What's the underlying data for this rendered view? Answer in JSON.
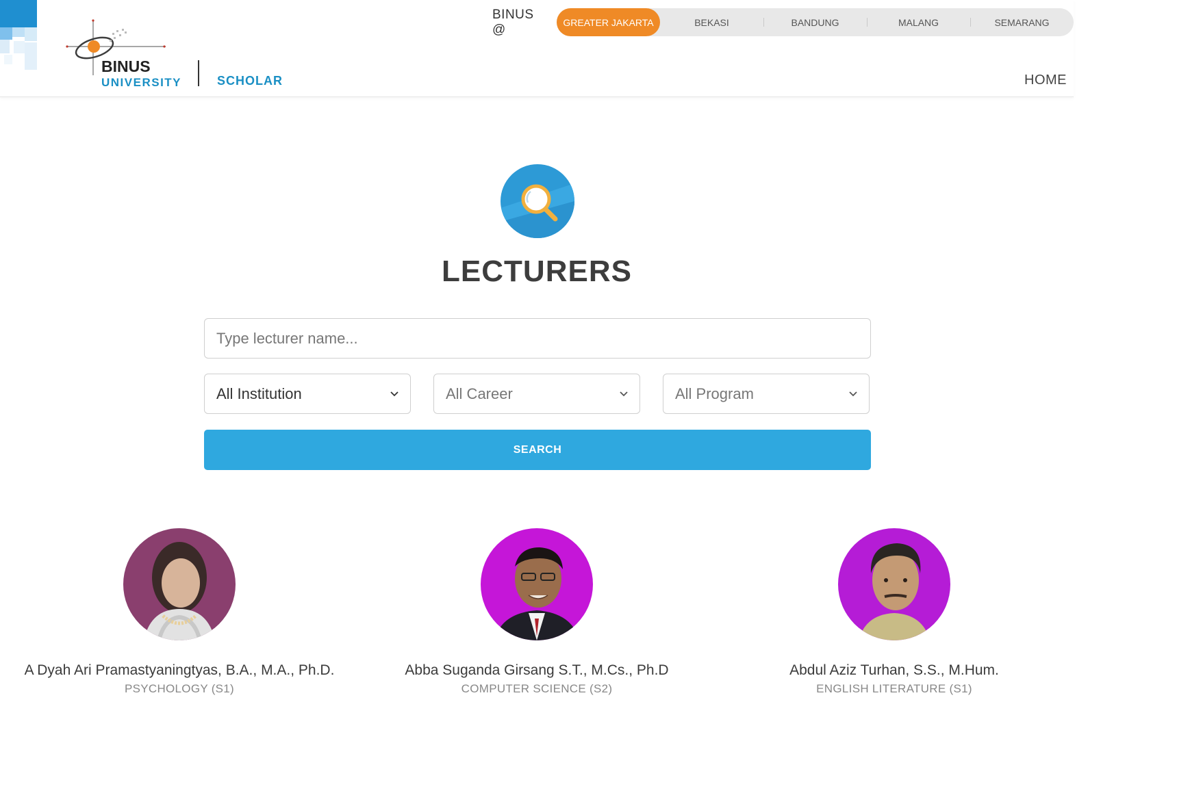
{
  "header": {
    "logo_text": "BINUS",
    "logo_subtext": "UNIVERSITY",
    "scholar_label": "SCHOLAR",
    "campus_label": "BINUS @",
    "campuses": [
      {
        "label": "GREATER JAKARTA",
        "active": true
      },
      {
        "label": "BEKASI",
        "active": false
      },
      {
        "label": "BANDUNG",
        "active": false
      },
      {
        "label": "MALANG",
        "active": false
      },
      {
        "label": "SEMARANG",
        "active": false
      }
    ],
    "home_label": "HOME",
    "accent_color": "#ef8a26",
    "brand_blue": "#1a8fc4"
  },
  "hero": {
    "icon": "magnifier-icon",
    "title": "LECTURERS"
  },
  "search": {
    "name_placeholder": "Type lecturer name...",
    "name_value": "",
    "institution": "All Institution",
    "career": "All Career",
    "program": "All Program",
    "button_label": "SEARCH",
    "button_color": "#2fa8df"
  },
  "lecturers": [
    {
      "name": "A Dyah Ari Pramastyaningtyas, B.A., M.A., Ph.D.",
      "department": "PSYCHOLOGY (S1)"
    },
    {
      "name": "Abba Suganda Girsang S.T., M.Cs., Ph.D",
      "department": "COMPUTER SCIENCE (S2)"
    },
    {
      "name": "Abdul Aziz Turhan, S.S., M.Hum.",
      "department": "ENGLISH LITERATURE (S1)"
    }
  ]
}
